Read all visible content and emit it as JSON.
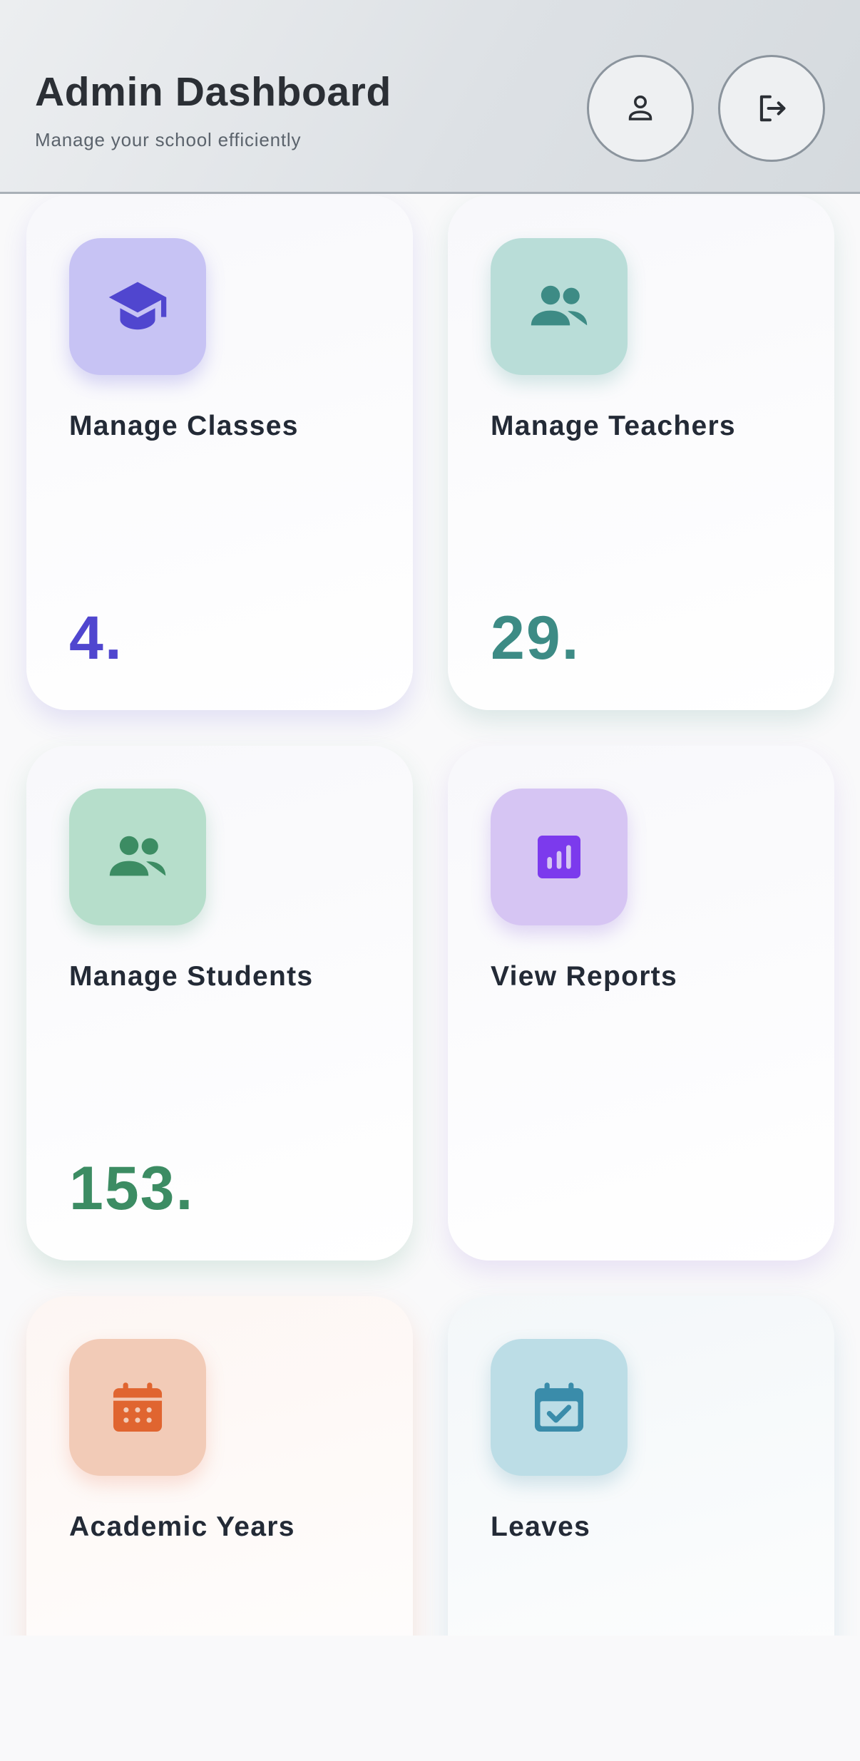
{
  "header": {
    "title": "Admin Dashboard",
    "subtitle": "Manage your school efficiently",
    "profile_icon": "person-icon",
    "logout_icon": "logout-icon"
  },
  "cards": [
    {
      "label": "Manage Classes",
      "count": "4.",
      "icon": "graduation-cap-icon",
      "accent": "#5046cf",
      "tile": "#c7c3f4"
    },
    {
      "label": "Manage Teachers",
      "count": "29.",
      "icon": "group-icon",
      "accent": "#3d8b85",
      "tile": "#b9ddd8"
    },
    {
      "label": "Manage Students",
      "count": "153.",
      "icon": "group-icon",
      "accent": "#3c8c63",
      "tile": "#b6decb"
    },
    {
      "label": "View Reports",
      "count": "",
      "icon": "bar-chart-icon",
      "accent": "#7c3aed",
      "tile": "#d6c5f3"
    },
    {
      "label": "Academic Years",
      "count": "",
      "icon": "calendar-icon",
      "accent": "#e06530",
      "tile": "#f2cbb7"
    },
    {
      "label": "Leaves",
      "count": "",
      "icon": "calendar-check-icon",
      "accent": "#3a8caa",
      "tile": "#bcdde6"
    }
  ]
}
